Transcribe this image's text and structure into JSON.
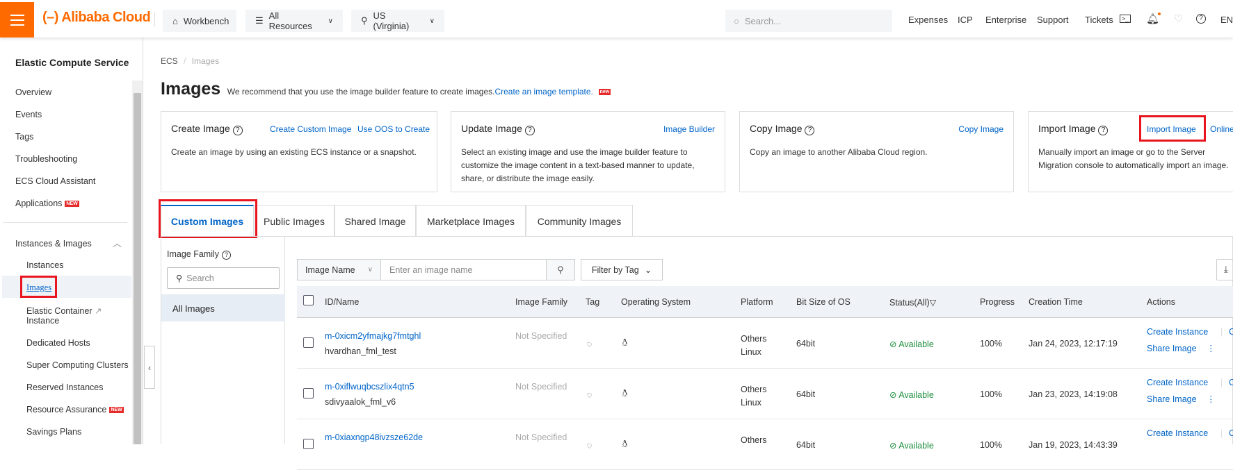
{
  "topbar": {
    "logo": "Alibaba Cloud",
    "workbench": "Workbench",
    "resources": "All Resources",
    "region": "US (Virginia)",
    "search_placeholder": "Search...",
    "links": [
      "Expenses",
      "ICP",
      "Enterprise",
      "Support",
      "Tickets"
    ],
    "lang": "EN"
  },
  "sidebar": {
    "title": "Elastic Compute Service",
    "items": [
      "Overview",
      "Events",
      "Tags",
      "Troubleshooting",
      "ECS Cloud Assistant",
      "Applications"
    ],
    "new_badge": "NEW",
    "group": "Instances & Images",
    "sub_items": [
      "Instances",
      "Images",
      "Elastic Container",
      "Instance",
      "Dedicated Hosts",
      "Super Computing Clusters",
      "Reserved Instances",
      "Resource Assurance",
      "Savings Plans"
    ]
  },
  "breadcrumb": {
    "root": "ECS",
    "sep": "/",
    "current": "Images"
  },
  "page": {
    "title": "Images",
    "subtitle": "We recommend that you use the image builder feature to create images.",
    "subtitle_link": "Create an image template.",
    "new_badge": "new"
  },
  "cards": [
    {
      "title": "Create Image",
      "links": [
        "Create Custom Image",
        "Use OOS to Create"
      ],
      "desc": "Create an image by using an existing ECS instance or a snapshot."
    },
    {
      "title": "Update Image",
      "links": [
        "Image Builder"
      ],
      "desc": "Select an existing image and use the image builder feature to customize the image content in a text-based manner to update, share, or distribute the image easily."
    },
    {
      "title": "Copy Image",
      "links": [
        "Copy Image"
      ],
      "desc": "Copy an image to another Alibaba Cloud region."
    },
    {
      "title": "Import Image",
      "links": [
        "Import Image",
        "Online"
      ],
      "desc": "Manually import an image or go to the Server Migration console to automatically import an image."
    }
  ],
  "tabs": [
    "Custom Images",
    "Public Images",
    "Shared Image",
    "Marketplace Images",
    "Community Images"
  ],
  "family": {
    "label": "Image Family",
    "search_placeholder": "Search",
    "all": "All Images"
  },
  "filter": {
    "select": "Image Name",
    "placeholder": "Enter an image name",
    "tag": "Filter by Tag"
  },
  "table": {
    "headers": [
      "ID/Name",
      "Image Family",
      "Tag",
      "Operating System",
      "Platform",
      "Bit Size of OS",
      "Status(All)",
      "Progress",
      "Creation Time",
      "Actions"
    ],
    "rows": [
      {
        "id": "m-0xicm2yfmajkg7fmtghl",
        "name": "hvardhan_fml_test",
        "family": "Not Specified",
        "platform1": "Others",
        "platform2": "Linux",
        "bits": "64bit",
        "status": "Available",
        "progress": "100%",
        "time": "Jan 24, 2023, 12:17:19",
        "a1": "Create Instance",
        "a2": "Copy",
        "a3": "Share Image"
      },
      {
        "id": "m-0xiflwuqbcszlix4qtn5",
        "name": "sdivyaalok_fml_v6",
        "family": "Not Specified",
        "platform1": "Others",
        "platform2": "Linux",
        "bits": "64bit",
        "status": "Available",
        "progress": "100%",
        "time": "Jan 23, 2023, 14:19:08",
        "a1": "Create Instance",
        "a2": "Copy",
        "a3": "Share Image"
      },
      {
        "id": "m-0xiaxngp48ivzsze62de",
        "name": "",
        "family": "Not Specified",
        "platform1": "Others",
        "platform2": "",
        "bits": "64bit",
        "status": "Available",
        "progress": "100%",
        "time": "Jan 19, 2023, 14:43:39",
        "a1": "Create Instance",
        "a2": "Copy",
        "a3": ""
      }
    ]
  }
}
